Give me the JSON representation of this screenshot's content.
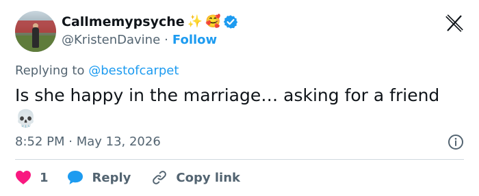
{
  "author": {
    "display_name": "Callmemypsyche",
    "emojis": [
      "✨",
      "🥰"
    ],
    "handle": "@KristenDavine",
    "separator": "·",
    "follow_label": "Follow",
    "verified": true,
    "verified_color": "#1d9bf0"
  },
  "reply_context": {
    "prefix": "Replying to",
    "mention": "@bestofcarpet"
  },
  "tweet": {
    "text": "Is she happy in the marriage… asking for a friend",
    "emoji": "💀"
  },
  "meta": {
    "timestamp": "8:52 PM · May 13, 2026"
  },
  "actions": {
    "like_count": "1",
    "reply_label": "Reply",
    "copy_label": "Copy link"
  },
  "colors": {
    "like": "#f91880",
    "reply_bubble": "#1d9bf0",
    "accent": "#1d9bf0",
    "muted": "#536471"
  },
  "icons": [
    "x-logo-icon",
    "verified-badge-icon",
    "info-icon",
    "heart-icon",
    "reply-bubble-icon",
    "link-icon"
  ]
}
